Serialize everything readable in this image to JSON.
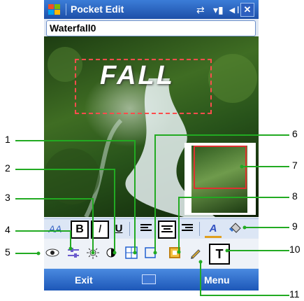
{
  "titlebar": {
    "title": "Pocket Edit"
  },
  "file": {
    "name": "Waterfall0"
  },
  "canvas": {
    "overlay_text": "FALL"
  },
  "toolbar1": {
    "font_label": "AA",
    "bold_label": "B",
    "italic_label": "I",
    "underline_label": "U",
    "text_color_label": "A"
  },
  "toolbar2": {
    "text_tool_label": "T"
  },
  "softkeys": {
    "left": "Exit",
    "right": "Menu"
  },
  "callouts": [
    "1",
    "2",
    "3",
    "4",
    "5",
    "6",
    "7",
    "8",
    "9",
    "10",
    "11"
  ]
}
